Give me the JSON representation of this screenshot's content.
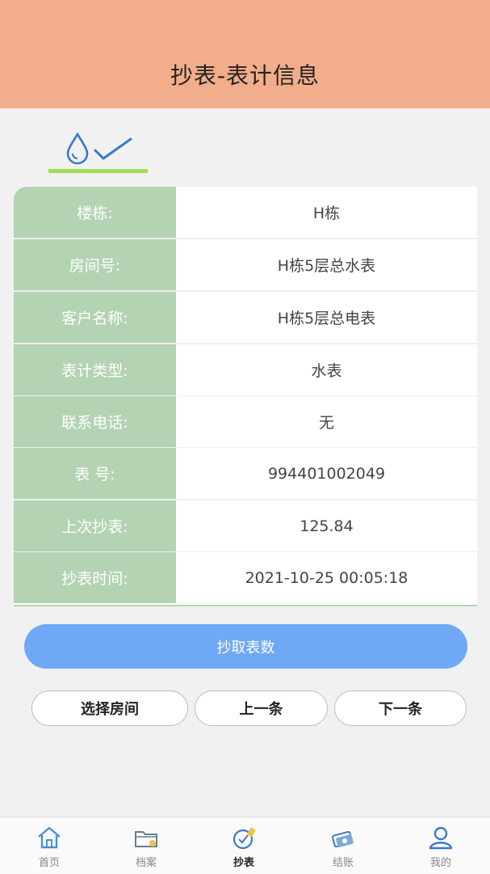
{
  "header": {
    "title": "抄表-表计信息"
  },
  "tab_icons": {
    "primary": "water-drop-icon",
    "secondary": "check-icon",
    "accent_color": "#a3dd52"
  },
  "info": {
    "rows": [
      {
        "label": "楼栋:",
        "value": "H栋"
      },
      {
        "label": "房间号:",
        "value": "H栋5层总水表"
      },
      {
        "label": "客户名称:",
        "value": "H栋5层总电表"
      },
      {
        "label": "表计类型:",
        "value": "水表"
      },
      {
        "label": "联系电话:",
        "value": "无"
      },
      {
        "label": "表 号:",
        "value": "994401002049"
      },
      {
        "label": "上次抄表:",
        "value": "125.84"
      },
      {
        "label": "抄表时间:",
        "value": "2021-10-25 00:05:18"
      }
    ]
  },
  "actions": {
    "read_meter": "抄取表数",
    "select_room": "选择房间",
    "prev": "上一条",
    "next": "下一条"
  },
  "tabbar": {
    "items": [
      {
        "label": "首页",
        "icon": "home-icon"
      },
      {
        "label": "档案",
        "icon": "folder-icon"
      },
      {
        "label": "抄表",
        "icon": "meter-icon"
      },
      {
        "label": "结账",
        "icon": "money-icon"
      },
      {
        "label": "我的",
        "icon": "user-icon"
      }
    ],
    "active": "抄表"
  },
  "colors": {
    "header_bg": "#f2ad8a",
    "label_bg": "#b3d3b3",
    "primary_button": "#6fa8f5",
    "tab_underline": "#a3dd52"
  }
}
